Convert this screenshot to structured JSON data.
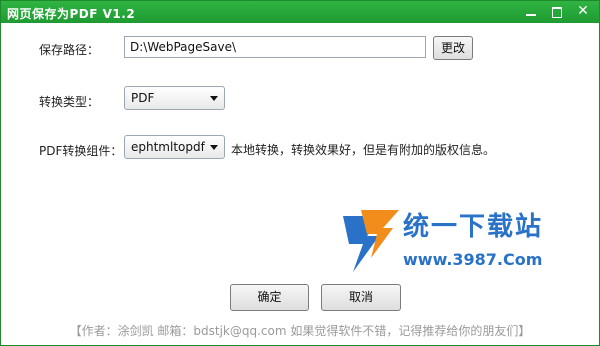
{
  "window": {
    "title": "网页保存为PDF  V1.2"
  },
  "titlebar": {
    "minimize_icon": "minimize-icon",
    "maximize_icon": "maximize-icon",
    "close_icon": "close-icon",
    "close_glyph": "✕"
  },
  "form": {
    "path_label": "保存路径：",
    "path_value": "D:\\WebPageSave\\",
    "change_button": "更改",
    "type_label": "转换类型：",
    "type_value": "PDF",
    "component_label": "PDF转换组件：",
    "component_value": "ephtmltopdf",
    "component_note": "本地转换，转换效果好，但是有附加的版权信息。"
  },
  "watermark": {
    "name": "统一下载站",
    "url": "www.3987.Com",
    "brand_colors": {
      "blue": "#2a72c8",
      "orange": "#f28c1a"
    }
  },
  "actions": {
    "ok": "确定",
    "cancel": "取消"
  },
  "footer": {
    "text": "【作者：涂剑凯  邮箱：bdstjk@qq.com  如果觉得软件不错，记得推荐给你的朋友们】"
  },
  "colors": {
    "titlebar": "#24a437",
    "border": "#1f8a2b"
  }
}
